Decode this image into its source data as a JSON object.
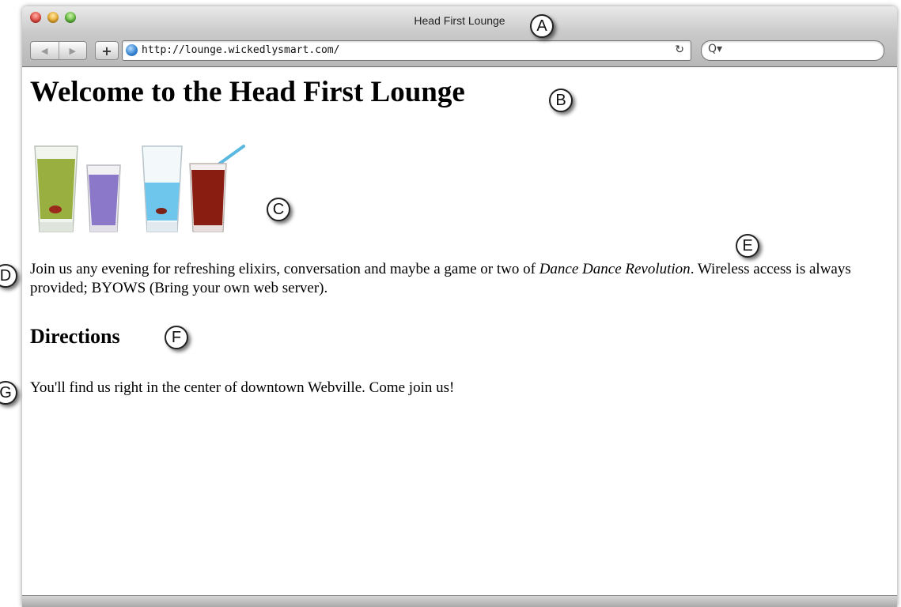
{
  "browser": {
    "title": "Head First Lounge",
    "url": "http://lounge.wickedlysmart.com/",
    "back_glyph": "◀",
    "forward_glyph": "▶",
    "add_glyph": "+",
    "reload_glyph": "↻",
    "search_glyph": "Q▾",
    "search_placeholder": ""
  },
  "page": {
    "heading": "Welcome to the Head First Lounge",
    "intro_text": "Join us any evening for refreshing elixirs, conversation and maybe a game or two of ",
    "intro_emphasis": "Dance Dance Revolution",
    "intro_text_end": ". Wireless access is always provided; BYOWS (Bring your own web server).",
    "subheading": "Directions",
    "directions_text": "You'll find us right in the center of downtown Webville. Come join us!"
  },
  "callouts": {
    "a": "A",
    "b": "B",
    "c": "C",
    "d": "D",
    "e": "E",
    "f": "F",
    "g": "G"
  },
  "colors": {
    "drink_green": "#8fa82c",
    "drink_purple": "#8c78c8",
    "drink_blue": "#6fc6ec",
    "drink_red": "#8a1d12",
    "straw": "#5bb8e0"
  }
}
